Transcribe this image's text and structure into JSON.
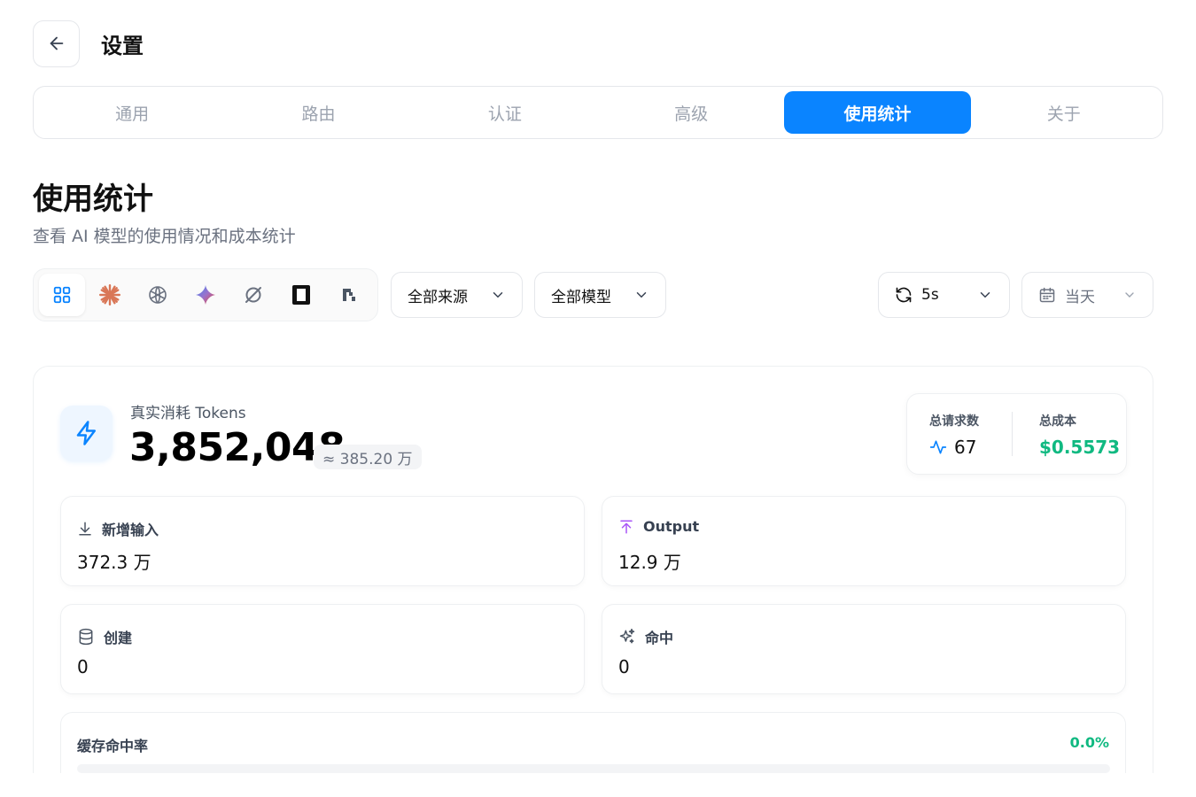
{
  "header": {
    "title": "设置"
  },
  "tabs": [
    {
      "label": "通用",
      "active": false
    },
    {
      "label": "路由",
      "active": false
    },
    {
      "label": "认证",
      "active": false
    },
    {
      "label": "高级",
      "active": false
    },
    {
      "label": "使用统计",
      "active": true
    },
    {
      "label": "关于",
      "active": false
    }
  ],
  "section": {
    "title": "使用统计",
    "subtitle": "查看 AI 模型的使用情况和成本统计"
  },
  "providers": [
    {
      "icon": "grid-icon",
      "active": true
    },
    {
      "icon": "anthropic-icon"
    },
    {
      "icon": "openai-icon"
    },
    {
      "icon": "gemini-icon"
    },
    {
      "icon": "grok-icon"
    },
    {
      "icon": "kimi-icon"
    },
    {
      "icon": "provider-icon"
    }
  ],
  "filters": {
    "source": "全部来源",
    "model": "全部模型",
    "refresh": "5s",
    "date": "当天"
  },
  "tokens": {
    "label": "真实消耗 Tokens",
    "value": "3,852,048",
    "approx": "≈ 385.20 万"
  },
  "summary": {
    "requests_label": "总请求数",
    "requests_value": "67",
    "cost_label": "总成本",
    "cost_value": "$0.5573"
  },
  "stats": {
    "input": {
      "label": "新增输入",
      "value": "372.3 万"
    },
    "output": {
      "label": "Output",
      "value": "12.9 万"
    },
    "create": {
      "label": "创建",
      "value": "0"
    },
    "hit": {
      "label": "命中",
      "value": "0"
    }
  },
  "cache": {
    "label": "缓存命中率",
    "value": "0.0%",
    "fraction": 0
  },
  "colors": {
    "accent": "#0a84ff",
    "success": "#10b981",
    "output_icon": "#a855f7"
  }
}
